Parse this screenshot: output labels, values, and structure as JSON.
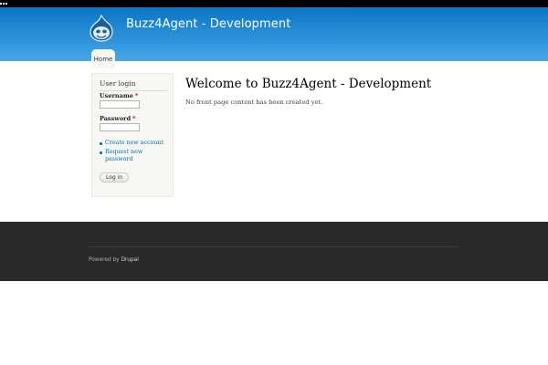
{
  "site": {
    "name": "Buzz4Agent - Development",
    "logo_icon": "drupal-drop-icon"
  },
  "nav": {
    "tabs": [
      {
        "label": "Home",
        "active": true
      }
    ]
  },
  "login_block": {
    "title": "User login",
    "username_label": "Username",
    "password_label": "Password",
    "required_marker": "*",
    "username_value": "",
    "password_value": "",
    "links": [
      {
        "label": "Create new account"
      },
      {
        "label": "Request new password"
      }
    ],
    "submit_label": "Log in"
  },
  "main": {
    "title": "Welcome to Buzz4Agent - Development",
    "message": "No front page content has been created yet."
  },
  "footer": {
    "powered_prefix": "Powered by",
    "powered_link": "Drupal"
  },
  "colors": {
    "header_top": "#0a76c4",
    "header_bottom": "#4aa7e6",
    "link": "#0071b3",
    "footer_bg": "#292929",
    "sidebar_bg": "#f6f6f2"
  }
}
